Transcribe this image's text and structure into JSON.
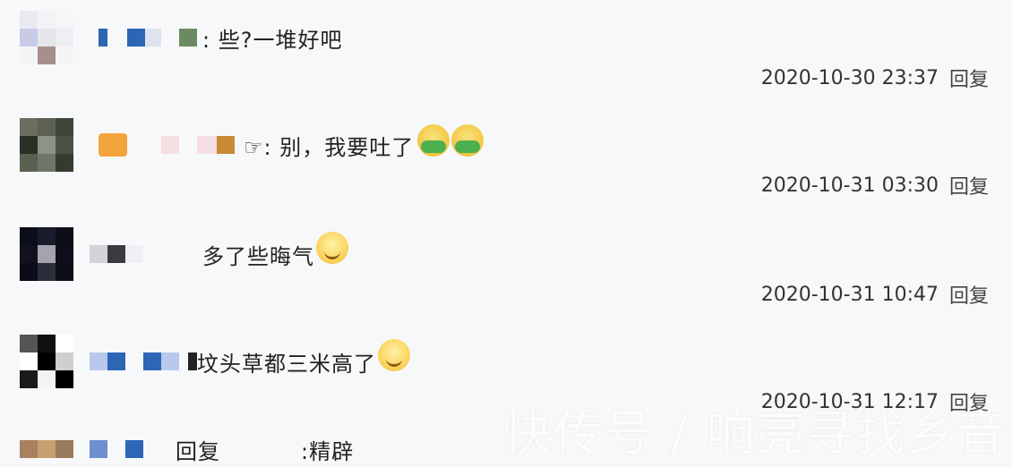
{
  "comments": [
    {
      "text": ": 些?一堆好吧",
      "time": "2020-10-30 23:37",
      "reply_label": "回复",
      "emojis": []
    },
    {
      "text": "☞: 别，我要吐了",
      "time": "2020-10-31 03:30",
      "reply_label": "回复",
      "emojis": [
        "vomit-icon",
        "vomit-icon"
      ]
    },
    {
      "text": "多了些晦气",
      "time": "2020-10-31 10:47",
      "reply_label": "回复",
      "emojis": [
        "grin-icon"
      ]
    },
    {
      "text": "坟头草都三米高了",
      "time": "2020-10-31 12:17",
      "reply_label": "回复",
      "emojis": [
        "smirk-icon"
      ]
    }
  ],
  "partial_comment": {
    "reply_prefix": "回复",
    "text": ":精辟"
  },
  "watermark": "快传号 / 响亮寻找乡音"
}
